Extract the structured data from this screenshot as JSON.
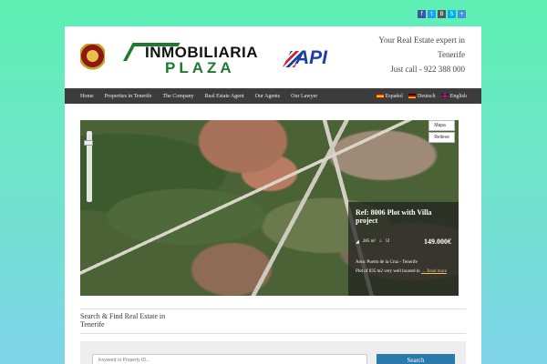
{
  "social": [
    {
      "icon": "facebook-icon",
      "glyph": "f",
      "color": "#3b5998"
    },
    {
      "icon": "twitter-icon",
      "glyph": "t",
      "color": "#1da1f2"
    },
    {
      "icon": "blogger-icon",
      "glyph": "B",
      "color": "#555555"
    },
    {
      "icon": "skype-icon",
      "glyph": "S",
      "color": "#00aff0"
    },
    {
      "icon": "share-icon",
      "glyph": "+",
      "color": "#4a90d9"
    }
  ],
  "header": {
    "logo_line1": "INMOBILIARIA",
    "logo_line2": "PLAZA",
    "api_logo": "API",
    "tagline_line1": "Your Real Estate expert in",
    "tagline_line2": "Tenerife",
    "tagline_line3": "Just call - 922 388 000"
  },
  "nav": {
    "items": [
      "Home",
      "Properties in Tenerife",
      "The Company",
      "Real Estate Agent",
      "Our Agents",
      "Our Lawyer"
    ],
    "languages": [
      "Español",
      "Deutsch",
      "English"
    ]
  },
  "map": {
    "type_buttons": [
      "Mapa",
      "Relieve"
    ]
  },
  "listing": {
    "title": "Ref: 8006 Plot with Villa project",
    "area": "285 m²",
    "baths": "5f",
    "price": "149.000€",
    "location": "Area: Puerto de la Cruz - Tenerife",
    "description": "Plot of 835 m2 very well located in",
    "more": "→ Read more"
  },
  "search": {
    "title": "Search & Find Real Estate in Tenerife",
    "placeholder": "Keyword or Property ID...",
    "button": "Search"
  }
}
